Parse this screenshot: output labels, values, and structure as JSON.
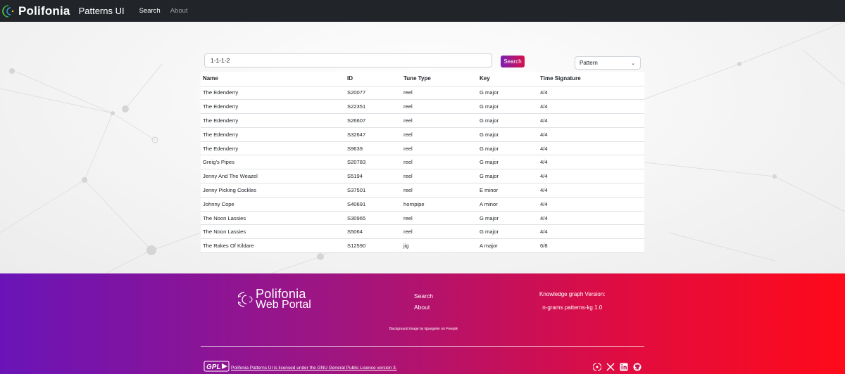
{
  "navbar": {
    "brand": "Polifonia",
    "subtitle": "Patterns UI",
    "links": [
      {
        "label": "Search",
        "active": true
      },
      {
        "label": "About",
        "active": false
      }
    ]
  },
  "search": {
    "value": "1-1-1-2",
    "button_label": "Search",
    "mode": "Pattern"
  },
  "table": {
    "headers": [
      "Name",
      "ID",
      "Tune Type",
      "Key",
      "Time Signature"
    ],
    "rows": [
      [
        "The Edenderry",
        "S20077",
        "reel",
        "G major",
        "4/4"
      ],
      [
        "The Edenderry",
        "S22351",
        "reel",
        "G major",
        "4/4"
      ],
      [
        "The Edenderry",
        "S26607",
        "reel",
        "G major",
        "4/4"
      ],
      [
        "The Edenderry",
        "S32647",
        "reel",
        "G major",
        "4/4"
      ],
      [
        "The Edenderry",
        "S9639",
        "reel",
        "G major",
        "4/4"
      ],
      [
        "Greig's Pipes",
        "S20783",
        "reel",
        "G major",
        "4/4"
      ],
      [
        "Jenny And The Weazel",
        "S5194",
        "reel",
        "G major",
        "4/4"
      ],
      [
        "Jenny Picking Cockles",
        "S37501",
        "reel",
        "E minor",
        "4/4"
      ],
      [
        "Johnny Cope",
        "S40691",
        "hornpipe",
        "A minor",
        "4/4"
      ],
      [
        "The Noon Lassies",
        "S30965",
        "reel",
        "G major",
        "4/4"
      ],
      [
        "The Noon Lassies",
        "S5064",
        "reel",
        "G major",
        "4/4"
      ],
      [
        "The Rakes Of Kildare",
        "S12590",
        "jig",
        "A major",
        "6/8"
      ]
    ]
  },
  "footer": {
    "logo_line1": "Polifonia",
    "logo_line2": "Web Portal",
    "links": [
      "Search",
      "About"
    ],
    "kg_label": "Knowledge graph Version:",
    "kg_version": "n-grams patterns-kg 1.0",
    "bg_credit": "Background image by kjpargeter on Freepik",
    "license": "Polifonia Patterns UI is licensed under the GNU General Public Licence version 3.",
    "gpl_badge": "GPL",
    "socials": [
      "polifonia-icon",
      "x-icon",
      "linkedin-icon",
      "github-icon"
    ]
  },
  "colors": {
    "navbar_bg": "#212529",
    "gradient_start": "#6a14b8",
    "gradient_end": "#ff0a1a",
    "accent_green": "#3bb54a",
    "accent_blue": "#2fa3d9"
  }
}
